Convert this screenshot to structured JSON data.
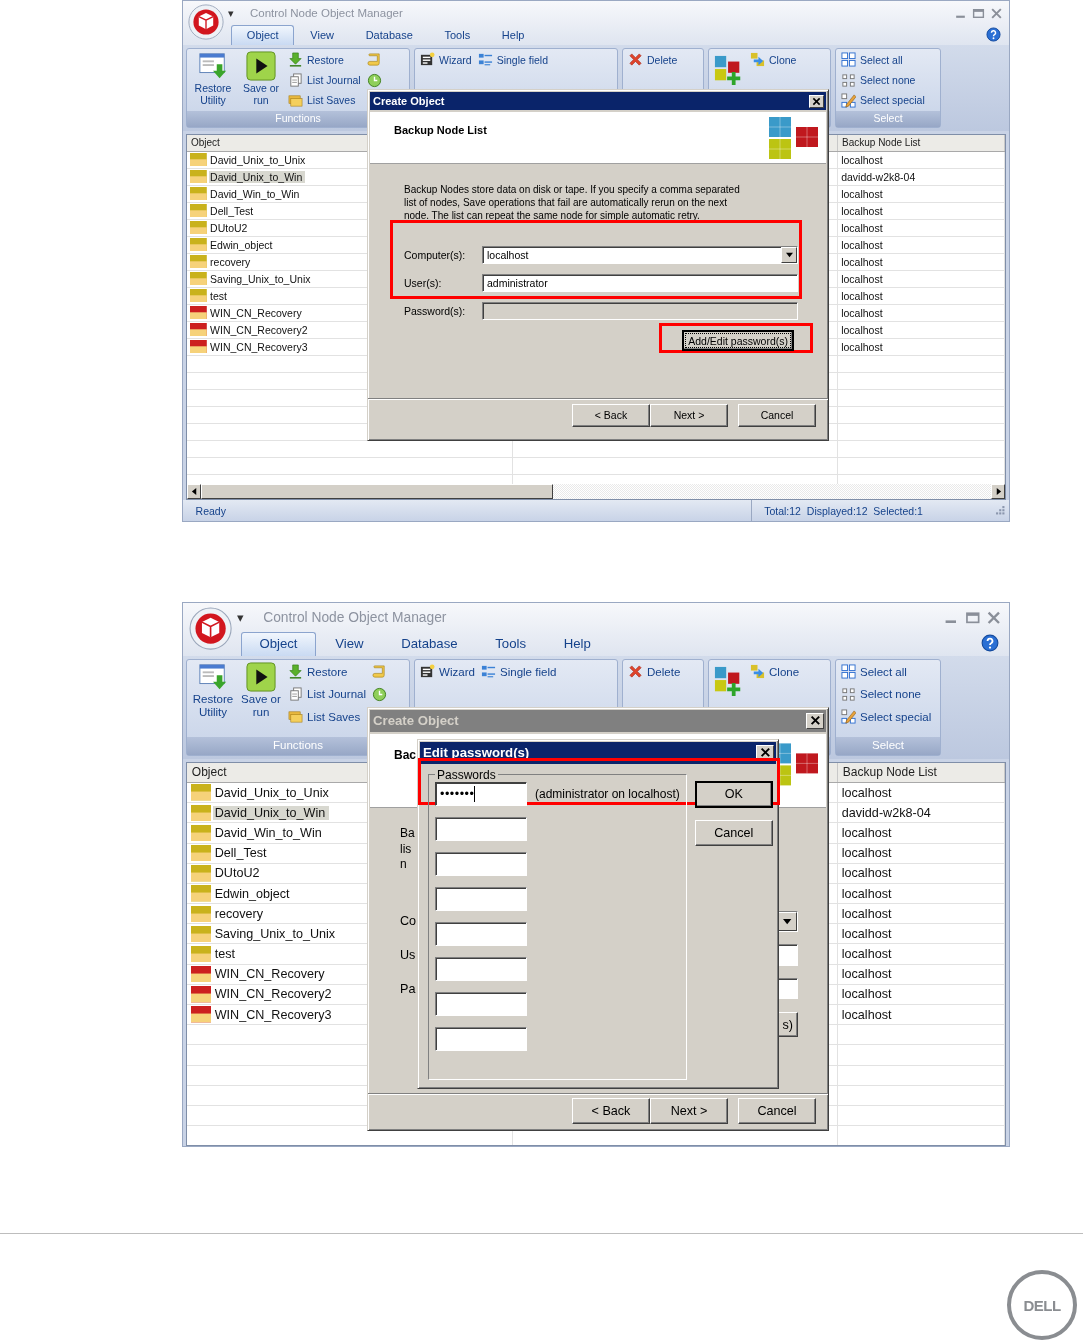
{
  "screenshots": [
    {
      "window": {
        "title": "Control Node Object Manager",
        "menu_glyph": "▾"
      },
      "tabs": [
        {
          "label": "Object",
          "selected": true
        },
        {
          "label": "View",
          "selected": false
        },
        {
          "label": "Database",
          "selected": false
        },
        {
          "label": "Tools",
          "selected": false
        },
        {
          "label": "Help",
          "selected": false
        }
      ],
      "ribbon": [
        {
          "label": "Functions",
          "columns": [
            {
              "kind": "large",
              "label": "Restore Utility"
            },
            {
              "kind": "large",
              "label": "Save or run"
            },
            {
              "kind": "stack",
              "items": [
                "Restore",
                "List Journal",
                "List Saves"
              ]
            },
            {
              "kind": "icons"
            }
          ]
        },
        {
          "columns": [
            {
              "kind": "stack",
              "items": [
                "Wizard"
              ]
            },
            {
              "kind": "stack",
              "items": [
                "Single field"
              ]
            }
          ]
        },
        {
          "columns": [
            {
              "kind": "stack",
              "items": [
                "Delete"
              ]
            }
          ]
        },
        {
          "columns": [
            {
              "kind": "tile"
            },
            {
              "kind": "stack",
              "items": [
                "Clone"
              ]
            }
          ]
        },
        {
          "label": "Select",
          "columns": [
            {
              "kind": "stack",
              "items": [
                "Select all",
                "Select none",
                "Select special"
              ]
            }
          ]
        }
      ],
      "table": {
        "object_header": "Object",
        "node_header": "Backup Node List",
        "rows": [
          {
            "object": "David_Unix_to_Unix",
            "backup_node": "localhost",
            "color": "#c9b21c",
            "selected": false
          },
          {
            "object": "David_Unix_to_Win",
            "backup_node": "davidd-w2k8-04",
            "color": "#c9b21c",
            "selected": true
          },
          {
            "object": "David_Win_to_Win",
            "backup_node": "localhost",
            "color": "#c9b21c",
            "selected": false
          },
          {
            "object": "Dell_Test",
            "backup_node": "localhost",
            "color": "#c9b21c",
            "selected": false
          },
          {
            "object": "DUtoU2",
            "backup_node": "localhost",
            "color": "#c9b21c",
            "selected": false
          },
          {
            "object": "Edwin_object",
            "backup_node": "localhost",
            "color": "#c9b21c",
            "selected": false
          },
          {
            "object": "recovery",
            "backup_node": "localhost",
            "color": "#c9b21c",
            "selected": false
          },
          {
            "object": "Saving_Unix_to_Unix",
            "backup_node": "localhost",
            "color": "#c9b21c",
            "selected": false
          },
          {
            "object": "test",
            "backup_node": "localhost",
            "color": "#c9b21c",
            "selected": false
          },
          {
            "object": "WIN_CN_Recovery",
            "backup_node": "localhost",
            "color": "#cc1f1f",
            "selected": false
          },
          {
            "object": "WIN_CN_Recovery2",
            "backup_node": "localhost",
            "color": "#cc1f1f",
            "selected": false
          },
          {
            "object": "WIN_CN_Recovery3",
            "backup_node": "localhost",
            "color": "#cc1f1f",
            "selected": false
          }
        ]
      },
      "status_bar": {
        "left": "Ready",
        "right": "Total:12  Displayed:12  Selected:1"
      },
      "create_dialog": {
        "active": true,
        "title": "Create Object",
        "heading": "Backup Node List",
        "description": [
          "Backup Nodes store data on disk or tape. If you specify a comma separated",
          "list of nodes, Save operations that fail are automatically rerun on the next",
          "node. The list can repeat the same node for simple automatic retry."
        ],
        "fields": [
          {
            "label": "Computer(s):",
            "value": "localhost",
            "kind": "combo",
            "disabled": false
          },
          {
            "label": "User(s):",
            "value": "administrator",
            "kind": "text",
            "disabled": false
          },
          {
            "label": "Password(s):",
            "kind": "text",
            "disabled": true
          }
        ],
        "fields_highlighted": true,
        "password_button": {
          "label": "Add/Edit password(s)",
          "highlighted": true,
          "focused": true
        },
        "buttons": [
          "< Back",
          "Next >",
          "Cancel"
        ]
      }
    },
    {
      "window": {
        "title": "Control Node Object Manager",
        "menu_glyph": "▾"
      },
      "tabs": [
        {
          "label": "Object",
          "selected": true
        },
        {
          "label": "View",
          "selected": false
        },
        {
          "label": "Database",
          "selected": false
        },
        {
          "label": "Tools",
          "selected": false
        },
        {
          "label": "Help",
          "selected": false
        }
      ],
      "ribbon": [
        {
          "label": "Functions",
          "columns": [
            {
              "kind": "large",
              "label": "Restore Utility"
            },
            {
              "kind": "large",
              "label": "Save or run"
            },
            {
              "kind": "stack",
              "items": [
                "Restore",
                "List Journal",
                "List Saves"
              ]
            },
            {
              "kind": "icons"
            }
          ]
        },
        {
          "columns": [
            {
              "kind": "stack",
              "items": [
                "Wizard"
              ]
            },
            {
              "kind": "stack",
              "items": [
                "Single field"
              ]
            }
          ]
        },
        {
          "columns": [
            {
              "kind": "stack",
              "items": [
                "Delete"
              ]
            }
          ]
        },
        {
          "columns": [
            {
              "kind": "tile"
            },
            {
              "kind": "stack",
              "items": [
                "Clone"
              ]
            }
          ]
        },
        {
          "label": "Select",
          "columns": [
            {
              "kind": "stack",
              "items": [
                "Select all",
                "Select none",
                "Select special"
              ]
            }
          ]
        }
      ],
      "table": {
        "object_header": "Object",
        "node_header": "Backup Node List",
        "rows": [
          {
            "object": "David_Unix_to_Unix",
            "backup_node": "localhost",
            "color": "#c9b21c",
            "selected": false
          },
          {
            "object": "David_Unix_to_Win",
            "backup_node": "davidd-w2k8-04",
            "color": "#c9b21c",
            "selected": true
          },
          {
            "object": "David_Win_to_Win",
            "backup_node": "localhost",
            "color": "#c9b21c",
            "selected": false
          },
          {
            "object": "Dell_Test",
            "backup_node": "localhost",
            "color": "#c9b21c",
            "selected": false
          },
          {
            "object": "DUtoU2",
            "backup_node": "localhost",
            "color": "#c9b21c",
            "selected": false
          },
          {
            "object": "Edwin_object",
            "backup_node": "localhost",
            "color": "#c9b21c",
            "selected": false
          },
          {
            "object": "recovery",
            "backup_node": "localhost",
            "color": "#c9b21c",
            "selected": false
          },
          {
            "object": "Saving_Unix_to_Unix",
            "backup_node": "localhost",
            "color": "#c9b21c",
            "selected": false
          },
          {
            "object": "test",
            "backup_node": "localhost",
            "color": "#c9b21c",
            "selected": false
          },
          {
            "object": "WIN_CN_Recovery",
            "backup_node": "localhost",
            "color": "#cc1f1f",
            "selected": false
          },
          {
            "object": "WIN_CN_Recovery2",
            "backup_node": "localhost",
            "color": "#cc1f1f",
            "selected": false
          },
          {
            "object": "WIN_CN_Recovery3",
            "backup_node": "localhost",
            "color": "#cc1f1f",
            "selected": false
          }
        ]
      },
      "create_dialog": {
        "active": false,
        "title": "Create Object",
        "heading": "Bac",
        "description": [
          "Ba",
          "lis",
          "n"
        ],
        "fields": [
          {
            "label": "Co",
            "kind": "combo"
          },
          {
            "label": "Us",
            "kind": "text"
          },
          {
            "label": "Pa",
            "kind": "text"
          }
        ],
        "password_button": {
          "label": "s)"
        },
        "buttons": [
          "< Back",
          "Next >",
          "Cancel"
        ]
      },
      "edit_dialog": {
        "title": "Edit password(s)",
        "group_label": "Passwords",
        "highlighted": true,
        "entries": [
          {
            "value": "•••••••",
            "note": "(administrator on localhost)",
            "focused": true
          },
          {
            "focused": false
          },
          {
            "focused": false
          },
          {
            "focused": false
          },
          {
            "focused": false
          },
          {
            "focused": false
          },
          {
            "focused": false
          },
          {
            "focused": false
          }
        ],
        "buttons": [
          "OK",
          "Cancel"
        ]
      }
    }
  ],
  "footer": {
    "logo_text": "DELL"
  }
}
